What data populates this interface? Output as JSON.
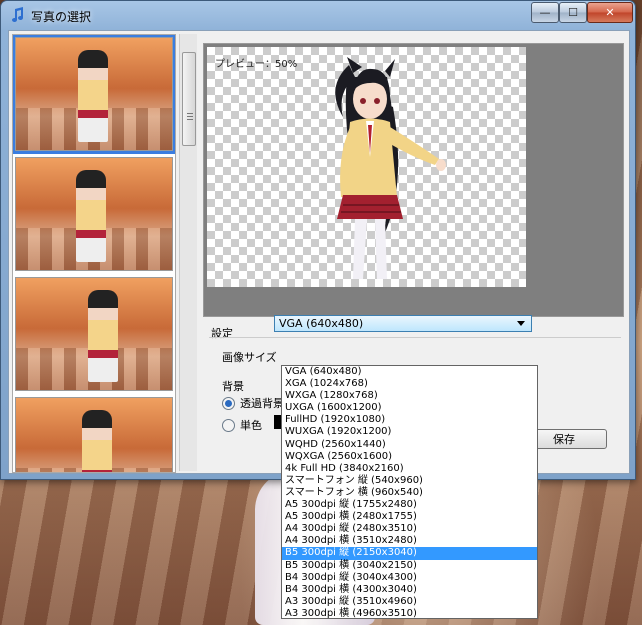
{
  "window": {
    "title": "写真の選択",
    "buttons": {
      "minimize": "—",
      "maximize": "☐",
      "close": "✕"
    }
  },
  "preview": {
    "label": "プレビュー：50%"
  },
  "settings": {
    "group_label": "設定",
    "image_size_label": "画像サイズ",
    "image_size_selected": "VGA (640x480)",
    "background_label": "背景",
    "transparent_option": "透過背景",
    "solid_option": "単色",
    "save_label": "保存"
  },
  "dropdown": {
    "options": [
      "VGA (640x480)",
      "XGA (1024x768)",
      "WXGA (1280x768)",
      "UXGA (1600x1200)",
      "FullHD (1920x1080)",
      "WUXGA (1920x1200)",
      "WQHD (2560x1440)",
      "WQXGA (2560x1600)",
      "4k Full HD (3840x2160)",
      "スマートフォン 縦 (540x960)",
      "スマートフォン 横 (960x540)",
      "A5 300dpi 縦 (1755x2480)",
      "A5 300dpi 横 (2480x1755)",
      "A4 300dpi 縦 (2480x3510)",
      "A4 300dpi 横 (3510x2480)",
      "B5 300dpi 縦 (2150x3040)",
      "B5 300dpi 横 (3040x2150)",
      "B4 300dpi 縦 (3040x4300)",
      "B4 300dpi 横 (4300x3040)",
      "A3 300dpi 縦 (3510x4960)",
      "A3 300dpi 横 (4960x3510)"
    ],
    "highlighted": "B5 300dpi 縦 (2150x3040)"
  },
  "colors": {
    "highlight": "#3399ff",
    "selection_border": "#3a7de0",
    "title_bar": "#8fb2d8"
  }
}
